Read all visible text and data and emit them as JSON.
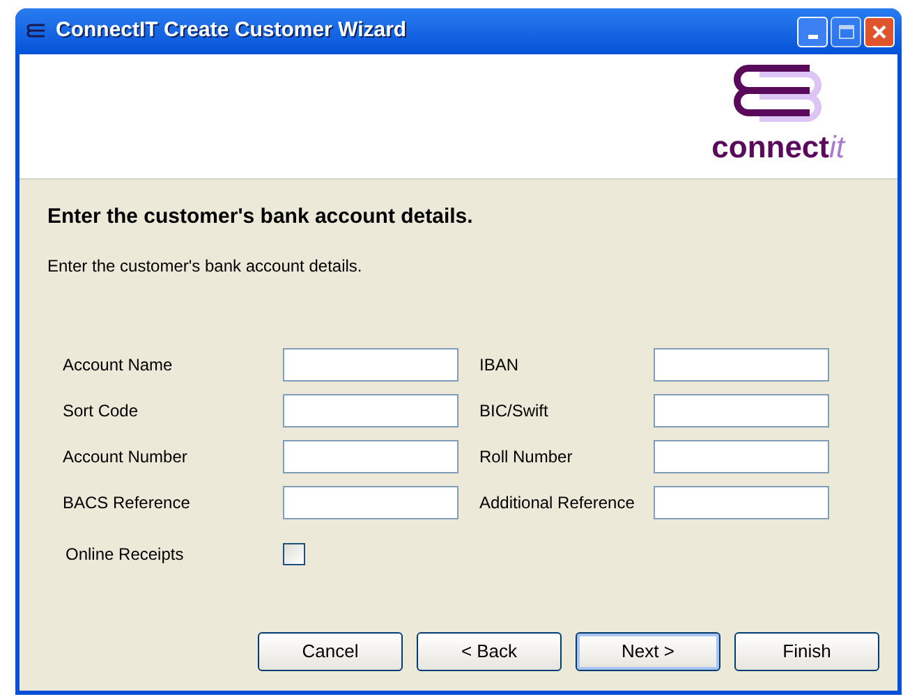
{
  "window": {
    "title": "ConnectIT Create Customer Wizard"
  },
  "logo": {
    "text": "connect",
    "accent": "it"
  },
  "heading": "Enter the customer's bank account details.",
  "description": "Enter the customer's bank account details.",
  "left_fields": [
    {
      "label": "Account Name"
    },
    {
      "label": "Sort Code"
    },
    {
      "label": "Account Number"
    },
    {
      "label": "BACS Reference"
    }
  ],
  "right_fields": [
    {
      "label": "IBAN"
    },
    {
      "label": "BIC/Swift"
    },
    {
      "label": "Roll Number"
    },
    {
      "label": "Additional Reference"
    }
  ],
  "online_receipts": {
    "label": "Online Receipts",
    "checked": false
  },
  "buttons": [
    {
      "label": "Cancel",
      "default": false
    },
    {
      "label": "< Back",
      "default": false
    },
    {
      "label": "Next >",
      "default": true
    },
    {
      "label": "Finish",
      "default": false
    }
  ]
}
